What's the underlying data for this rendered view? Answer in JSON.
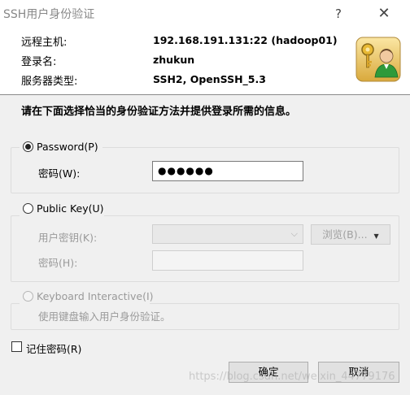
{
  "window": {
    "title": "SSH用户身份验证",
    "help_glyph": "?",
    "close_glyph": "✕"
  },
  "info": {
    "remote_host_label": "远程主机:",
    "remote_host_value": "192.168.191.131:22 (hadoop01)",
    "login_label": "登录名:",
    "login_value": "zhukun",
    "server_type_label": "服务器类型:",
    "server_type_value": "SSH2, OpenSSH_5.3"
  },
  "instruction": "请在下面选择恰当的身份验证方法并提供登录所需的信息。",
  "password_option": {
    "label": "Password(P)",
    "selected": true,
    "field_label": "密码(W):",
    "field_value": "●●●●●●"
  },
  "public_key_option": {
    "label": "Public Key(U)",
    "selected": false,
    "user_key_label": "用户密钥(K):",
    "user_key_value": "",
    "browse_label": "浏览(B)...",
    "passphrase_label": "密码(H):",
    "passphrase_value": ""
  },
  "keyboard_option": {
    "label": "Keyboard Interactive(I)",
    "selected": false,
    "description": "使用键盘输入用户身份验证。"
  },
  "remember_password": {
    "label": "记住密码(R)",
    "checked": false
  },
  "buttons": {
    "ok": "确定",
    "cancel": "取消"
  },
  "watermark": "https://blog.csdn.net/weixin_44779176",
  "colors": {
    "panel_bg": "#f0f0f0",
    "disabled_text": "#9a9a9a",
    "logo_bg": "#e9c66b"
  },
  "icons": {
    "logo": "keys-user-icon",
    "combo": "chevron-down-icon",
    "browse": "dropdown-triangle-icon"
  }
}
